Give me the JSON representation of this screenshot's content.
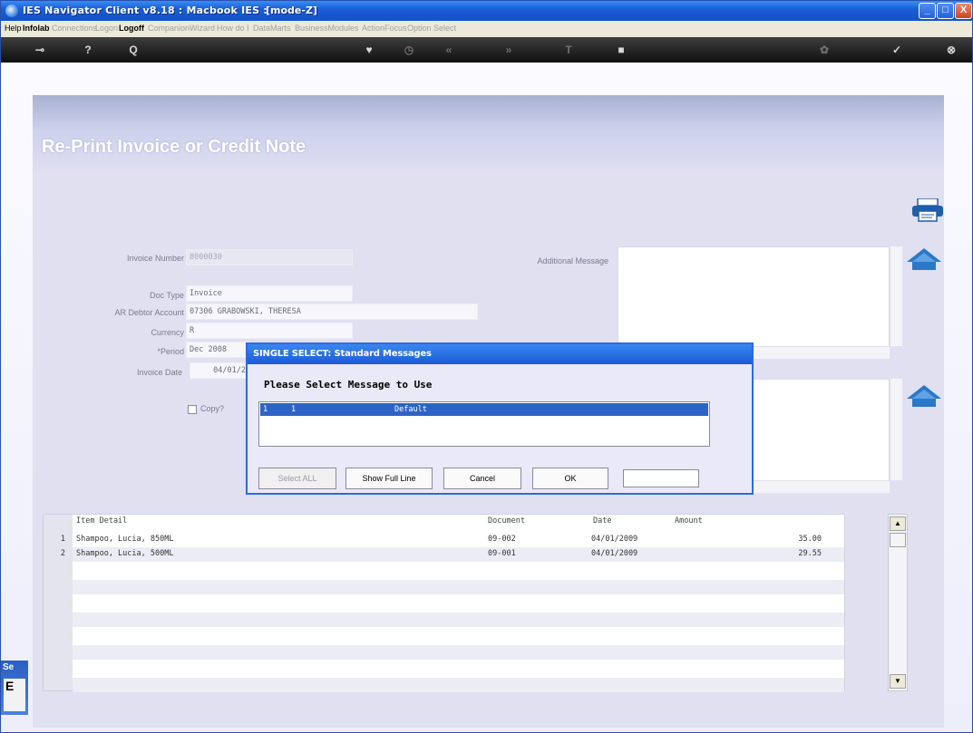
{
  "window": {
    "title": "IES Navigator Client v8.18 : Macbook IES :",
    "mode": "[mode-Z]",
    "min_label": "_",
    "max_label": "□",
    "close_label": "X"
  },
  "menu": [
    {
      "label": "Help",
      "style": "active"
    },
    {
      "label": "Infolab",
      "style": "bold"
    },
    {
      "label": "Connections",
      "style": "dim"
    },
    {
      "label": "Logon",
      "style": "dim"
    },
    {
      "label": "Logoff",
      "style": "bold"
    },
    {
      "label": "Companion",
      "style": "dim"
    },
    {
      "label": "Wizard",
      "style": "dim"
    },
    {
      "label": "How do I",
      "style": "dim"
    },
    {
      "label": "DataMarts",
      "style": "dim"
    },
    {
      "label": "BusinessModules",
      "style": "dim"
    },
    {
      "label": "ActionFocus",
      "style": "dim"
    },
    {
      "label": "Option Select",
      "style": "dim"
    }
  ],
  "toolbar": {
    "key_icon": "⊸",
    "help_icon": "?",
    "search_icon": "Q",
    "heart_icon": "♥",
    "clock_icon": "◷",
    "back_icon": "«",
    "forward_icon": "»",
    "text_icon": "T",
    "stop_icon": "■",
    "settings_icon": "✿",
    "ok_icon": "✓",
    "close_icon": "⊗"
  },
  "page": {
    "title": "Re-Print Invoice or Credit Note"
  },
  "form": {
    "invoice_number_label": "Invoice Number",
    "invoice_number_value": "8000030",
    "doc_type_label": "Doc Type",
    "doc_type_value": "Invoice",
    "debtor_label": "AR Debtor Account",
    "debtor_value": "07306 GRABOWSKI, THERESA",
    "currency_label": "Currency",
    "currency_value": "R",
    "period_label": "*Period",
    "period_value": "Dec 2008",
    "invoice_date_label": "Invoice Date",
    "invoice_date_value": "04/01/2",
    "copy_label": "Copy?",
    "additional_message_label": "Additional Message"
  },
  "table": {
    "headers": {
      "item": "Item Detail",
      "document": "Document",
      "date": "Date",
      "amount": "Amount"
    },
    "rows": [
      {
        "num": "1",
        "item": "Shampoo, Lucia, 850ML",
        "document": "09-002",
        "date": "04/01/2009",
        "amount": "35.00"
      },
      {
        "num": "2",
        "item": "Shampoo, Lucia, 500ML",
        "document": "09-001",
        "date": "04/01/2009",
        "amount": "29.55"
      }
    ],
    "scroll_up": "▲",
    "scroll_down": "▼"
  },
  "left_tab": {
    "label": "Se",
    "inner": "E"
  },
  "dialog": {
    "title": "SINGLE SELECT: Standard Messages",
    "prompt": "Please Select Message to Use",
    "items": [
      {
        "col1": "1",
        "col2": "1",
        "label": "Default"
      }
    ],
    "select_all_label": "Select ALL",
    "show_full_label": "Show Full Line",
    "cancel_label": "Cancel",
    "ok_label": "OK",
    "input_value": ""
  },
  "colors": {
    "title_bar": "#1a5fd6",
    "dialog_selection": "#2e63c6",
    "panel": "#e0e0f1",
    "accent_icon": "#2a78c8"
  }
}
